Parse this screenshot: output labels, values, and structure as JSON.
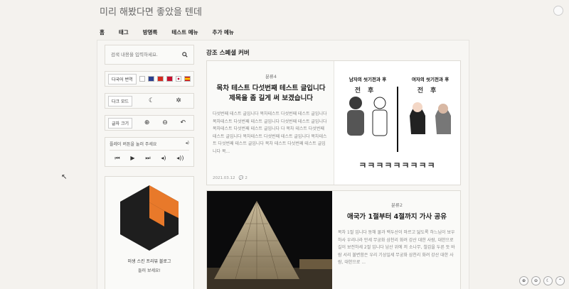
{
  "blog": {
    "title": "미리 해봤다면 좋았을 텐데"
  },
  "nav": [
    "홈",
    "태그",
    "방명록",
    "테스트 메뉴",
    "추가 메뉴"
  ],
  "sidebar": {
    "search_placeholder": "검색 내용을 입력하세요.",
    "translate_label": "다국어 번역",
    "dark_mode_label": "다크 모드",
    "font_size_label": "글자 크기",
    "player_label": "플레이 버튼을 눌러 주세요",
    "skin_caption": "미생 스킨 프리뷰 블로그",
    "skin_sub": "들러 보세요!"
  },
  "main": {
    "section_title": "강조 스페셜 커버",
    "cards": [
      {
        "category": "분류4",
        "headline": "목차 테스트 다섯번째 테스트 글입니다 제목을 좀 길게 써 보겠습니다",
        "excerpt": "다섯번째 테스트 글입니다 목차테스트 다섯번째 테스트 글입니다 목차테스트 다섯번째 테스트 글입니다 다섯번째 테스트 글입니다 목차테스트 다섯번째 테스트 글입니다 다 목차 테스트 다섯번째 테스트 글입니다 목차테스트 다섯번째 테스트 글입니다 목차테스트 다섯번째 테스트 글입니다 목차 테스트 다섯번째 테스트 글입니다 목...",
        "date": "2021.03.12",
        "comments": "2",
        "comic": {
          "left_title": "남자의 씻기전과 후",
          "right_title": "여자의 씻기전과 후",
          "before": "전",
          "after": "후",
          "caption": "ㅋㅋㅋㅋㅋㅋㅋㅋㅋ"
        }
      },
      {
        "category": "분류2",
        "headline": "애국가 1절부터 4절까지 가사 공유",
        "excerpt": "목차 1절 입니다 동해 물과 백두산이 마르고 닳도록 하느님이 보우하사 우리나라 만세 무궁화 삼천리 화려 강산 대한 사람, 대한으로 길이 보전하세 2절 입니다 남산 위에 저 소나무, 철갑을 두른 듯 바람 서리 불변함은 우리 기상일세 무궁화 삼천리 화려 강산 대한 사람, 대한으로 ..."
      }
    ]
  },
  "colors": {
    "accent": "#e8792a",
    "dark": "#222222"
  }
}
